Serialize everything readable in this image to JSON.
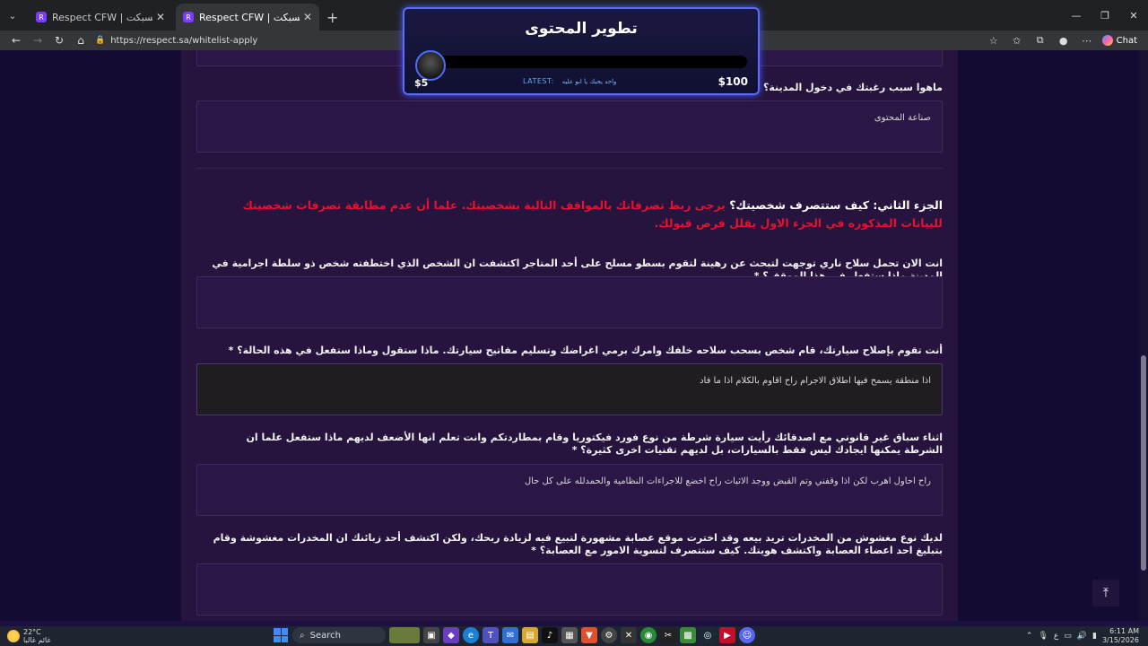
{
  "browser": {
    "tabs": [
      {
        "label": "Respect CFW | ريسبكت",
        "favicon": "R"
      },
      {
        "label": "Respect CFW | ريسبكت",
        "favicon": "R"
      }
    ],
    "url": "https://respect.sa/whitelist-apply",
    "chat_label": "Chat"
  },
  "overlay": {
    "title": "تطوير المحتوى",
    "min": "$5",
    "max": "$100",
    "latest_label": "LATEST:",
    "latest_name": "واحد يحبك يا ابو عليه"
  },
  "form": {
    "q_reason": "ماهوا سبب رغبتك في دخول المدينة؟ *",
    "a_reason": "صناعة المحتوى",
    "section_title": "الجزء الثاني: كيف ستتصرف شخصيتك؟",
    "section_warning": "يرجى ربط تصرفاتك بالمواقف التالية بشخصيتك. علما أن عدم مطابقة تصرفات شخصيتك للبيانات المذكوره في الجزء الاول يقلل فرص قبولك.",
    "q1": "انت الان تحمل سلاح ناري توجهت لتبحث عن رهينة لتقوم بسطو مسلح على أحد المتاجر اكتشفت ان الشخص الذي اختطفته شخص ذو سلطة اجرامية في المدينة ماذا ستفعل في هذا الموقف؟ *",
    "a1": "",
    "q2": "أنت تقوم بإصلاح سيارتك، قام شخص بسحب سلاحه خلفك وامرك برمي اغراضك وتسليم مفاتيح سيارتك. ماذا ستقول وماذا ستفعل في هذه الحالة؟ *",
    "a2": "اذا منطقة يسمح فيها اطلاق الاجرام راح اقاوم بالكلام اذا ما فاد",
    "q3": "اثناء سباق غير قانوني مع اصدقائك رأيت سيارة شرطة من نوع فورد فيكتوريا وقام بمطاردتكم وانت تعلم انها الأضعف لديهم ماذا ستفعل علما ان الشرطة يمكنها ايجادك ليس فقط بالسيارات، بل لديهم تقنيات اخرى كثيرة؟ *",
    "a3": "راح احاول اهرب لكن اذا وقفني وتم القبض ووجد الاثبات راح اخضع للاجراءات النظامية والحمدلله على كل حال",
    "q4": "لديك نوع مغشوش من المخدرات تريد بيعه وقد اخترت موقع عصابة مشهورة لتبيع فيه لزيادة ربحك، ولكن اكتشف أحد زبائنك ان المخدرات مغشوشة وقام بتبليغ احد اعضاء العصابة واكتشف هويتك. كيف ستتصرف لتسوية الامور مع العصابة؟ *",
    "a4": ""
  },
  "taskbar": {
    "temp": "22°C",
    "weather_desc": "غائم غالبا",
    "search_label": "Search",
    "lang": "ع",
    "time": "6:11 AM",
    "date": "3/15/2026"
  },
  "colors": {
    "panel": "#26143f",
    "warning": "#e5122c",
    "overlay_border": "#5a6cff"
  }
}
